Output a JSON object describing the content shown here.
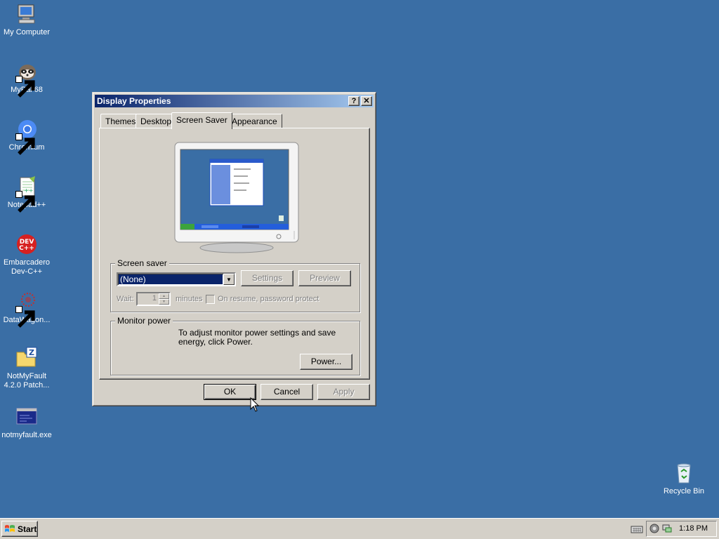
{
  "desktop": {
    "icons": [
      {
        "label": "My Computer"
      },
      {
        "label": "MyPal 68"
      },
      {
        "label": "Chromium"
      },
      {
        "label": "Notepad++"
      },
      {
        "label": "Embarcadero Dev-C++"
      },
      {
        "label": "DataWagon..."
      },
      {
        "label": "NotMyFault 4.2.0 Patch..."
      },
      {
        "label": "notmyfault.exe"
      },
      {
        "label": "Recycle Bin"
      }
    ]
  },
  "dialog": {
    "title": "Display Properties",
    "help_btn": "?",
    "close_btn": "✕",
    "tabs": [
      {
        "label": "Themes"
      },
      {
        "label": "Desktop"
      },
      {
        "label": "Screen Saver"
      },
      {
        "label": "Appearance"
      }
    ],
    "active_tab": "Screen Saver",
    "screensaver": {
      "group_label": "Screen saver",
      "selected": "(None)",
      "settings_label": "Settings",
      "preview_label": "Preview",
      "wait_label": "Wait:",
      "wait_value": "1",
      "minutes_label": "minutes",
      "resume_label": "On resume, password protect"
    },
    "monitor_power": {
      "group_label": "Monitor power",
      "text": "To adjust monitor power settings and save energy, click Power.",
      "power_label": "Power..."
    },
    "footer": {
      "ok_label": "OK",
      "cancel_label": "Cancel",
      "apply_label": "Apply"
    }
  },
  "taskbar": {
    "start_label": "Start",
    "clock": "1:18 PM"
  },
  "colors": {
    "desktop_bg": "#3a6ea5",
    "face": "#d4d0c8",
    "title_start": "#0a246a",
    "title_end": "#a6caf0"
  }
}
